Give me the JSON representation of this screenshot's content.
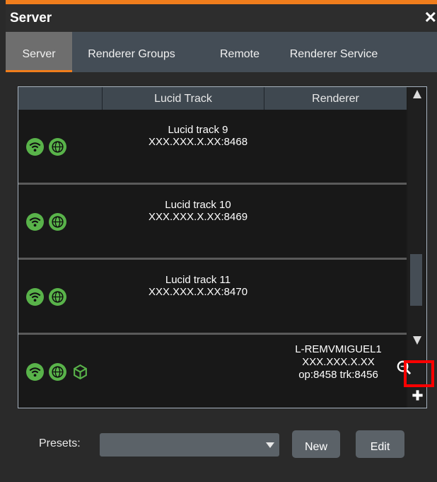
{
  "window": {
    "title": "Server",
    "close_glyph": "✕"
  },
  "tabs": [
    {
      "label": "Server",
      "active": true
    },
    {
      "label": "Renderer Groups",
      "active": false
    },
    {
      "label": "Remote",
      "active": false
    },
    {
      "label": "Renderer Service",
      "active": false
    }
  ],
  "table": {
    "headers": [
      "",
      "Lucid Track",
      "Renderer"
    ],
    "rows": [
      {
        "track_name": "Lucid track 9",
        "track_address": "XXX.XXX.X.XX:8468",
        "renderer_name": "",
        "renderer_address": "",
        "renderer_ports": "",
        "icons": [
          "wifi-icon",
          "globe-icon"
        ]
      },
      {
        "track_name": "Lucid track 10",
        "track_address": "XXX.XXX.X.XX:8469",
        "renderer_name": "",
        "renderer_address": "",
        "renderer_ports": "",
        "icons": [
          "wifi-icon",
          "globe-icon"
        ]
      },
      {
        "track_name": "Lucid track 11",
        "track_address": "XXX.XXX.X.XX:8470",
        "renderer_name": "",
        "renderer_address": "",
        "renderer_ports": "",
        "icons": [
          "wifi-icon",
          "globe-icon"
        ]
      },
      {
        "track_name": "",
        "track_address": "",
        "renderer_name": "L-REMVMIGUEL1",
        "renderer_address": "XXX.XXX.X.XX",
        "renderer_ports": "op:8458 trk:8456",
        "icons": [
          "wifi-icon",
          "globe-icon",
          "cube-outline-icon"
        ]
      }
    ]
  },
  "footer": {
    "presets_label": "Presets:",
    "presets_value": "",
    "new_label": "New",
    "edit_label": "Edit"
  },
  "colors": {
    "accent": "#f07d1c",
    "status_green": "#59b34a",
    "highlight_red": "#ff0000"
  },
  "icons": [
    "close-icon",
    "wifi-icon",
    "globe-icon",
    "cube-outline-icon",
    "zoom-icon",
    "plus-icon",
    "dropdown-caret-icon",
    "scroll-up-icon",
    "scroll-down-icon"
  ]
}
